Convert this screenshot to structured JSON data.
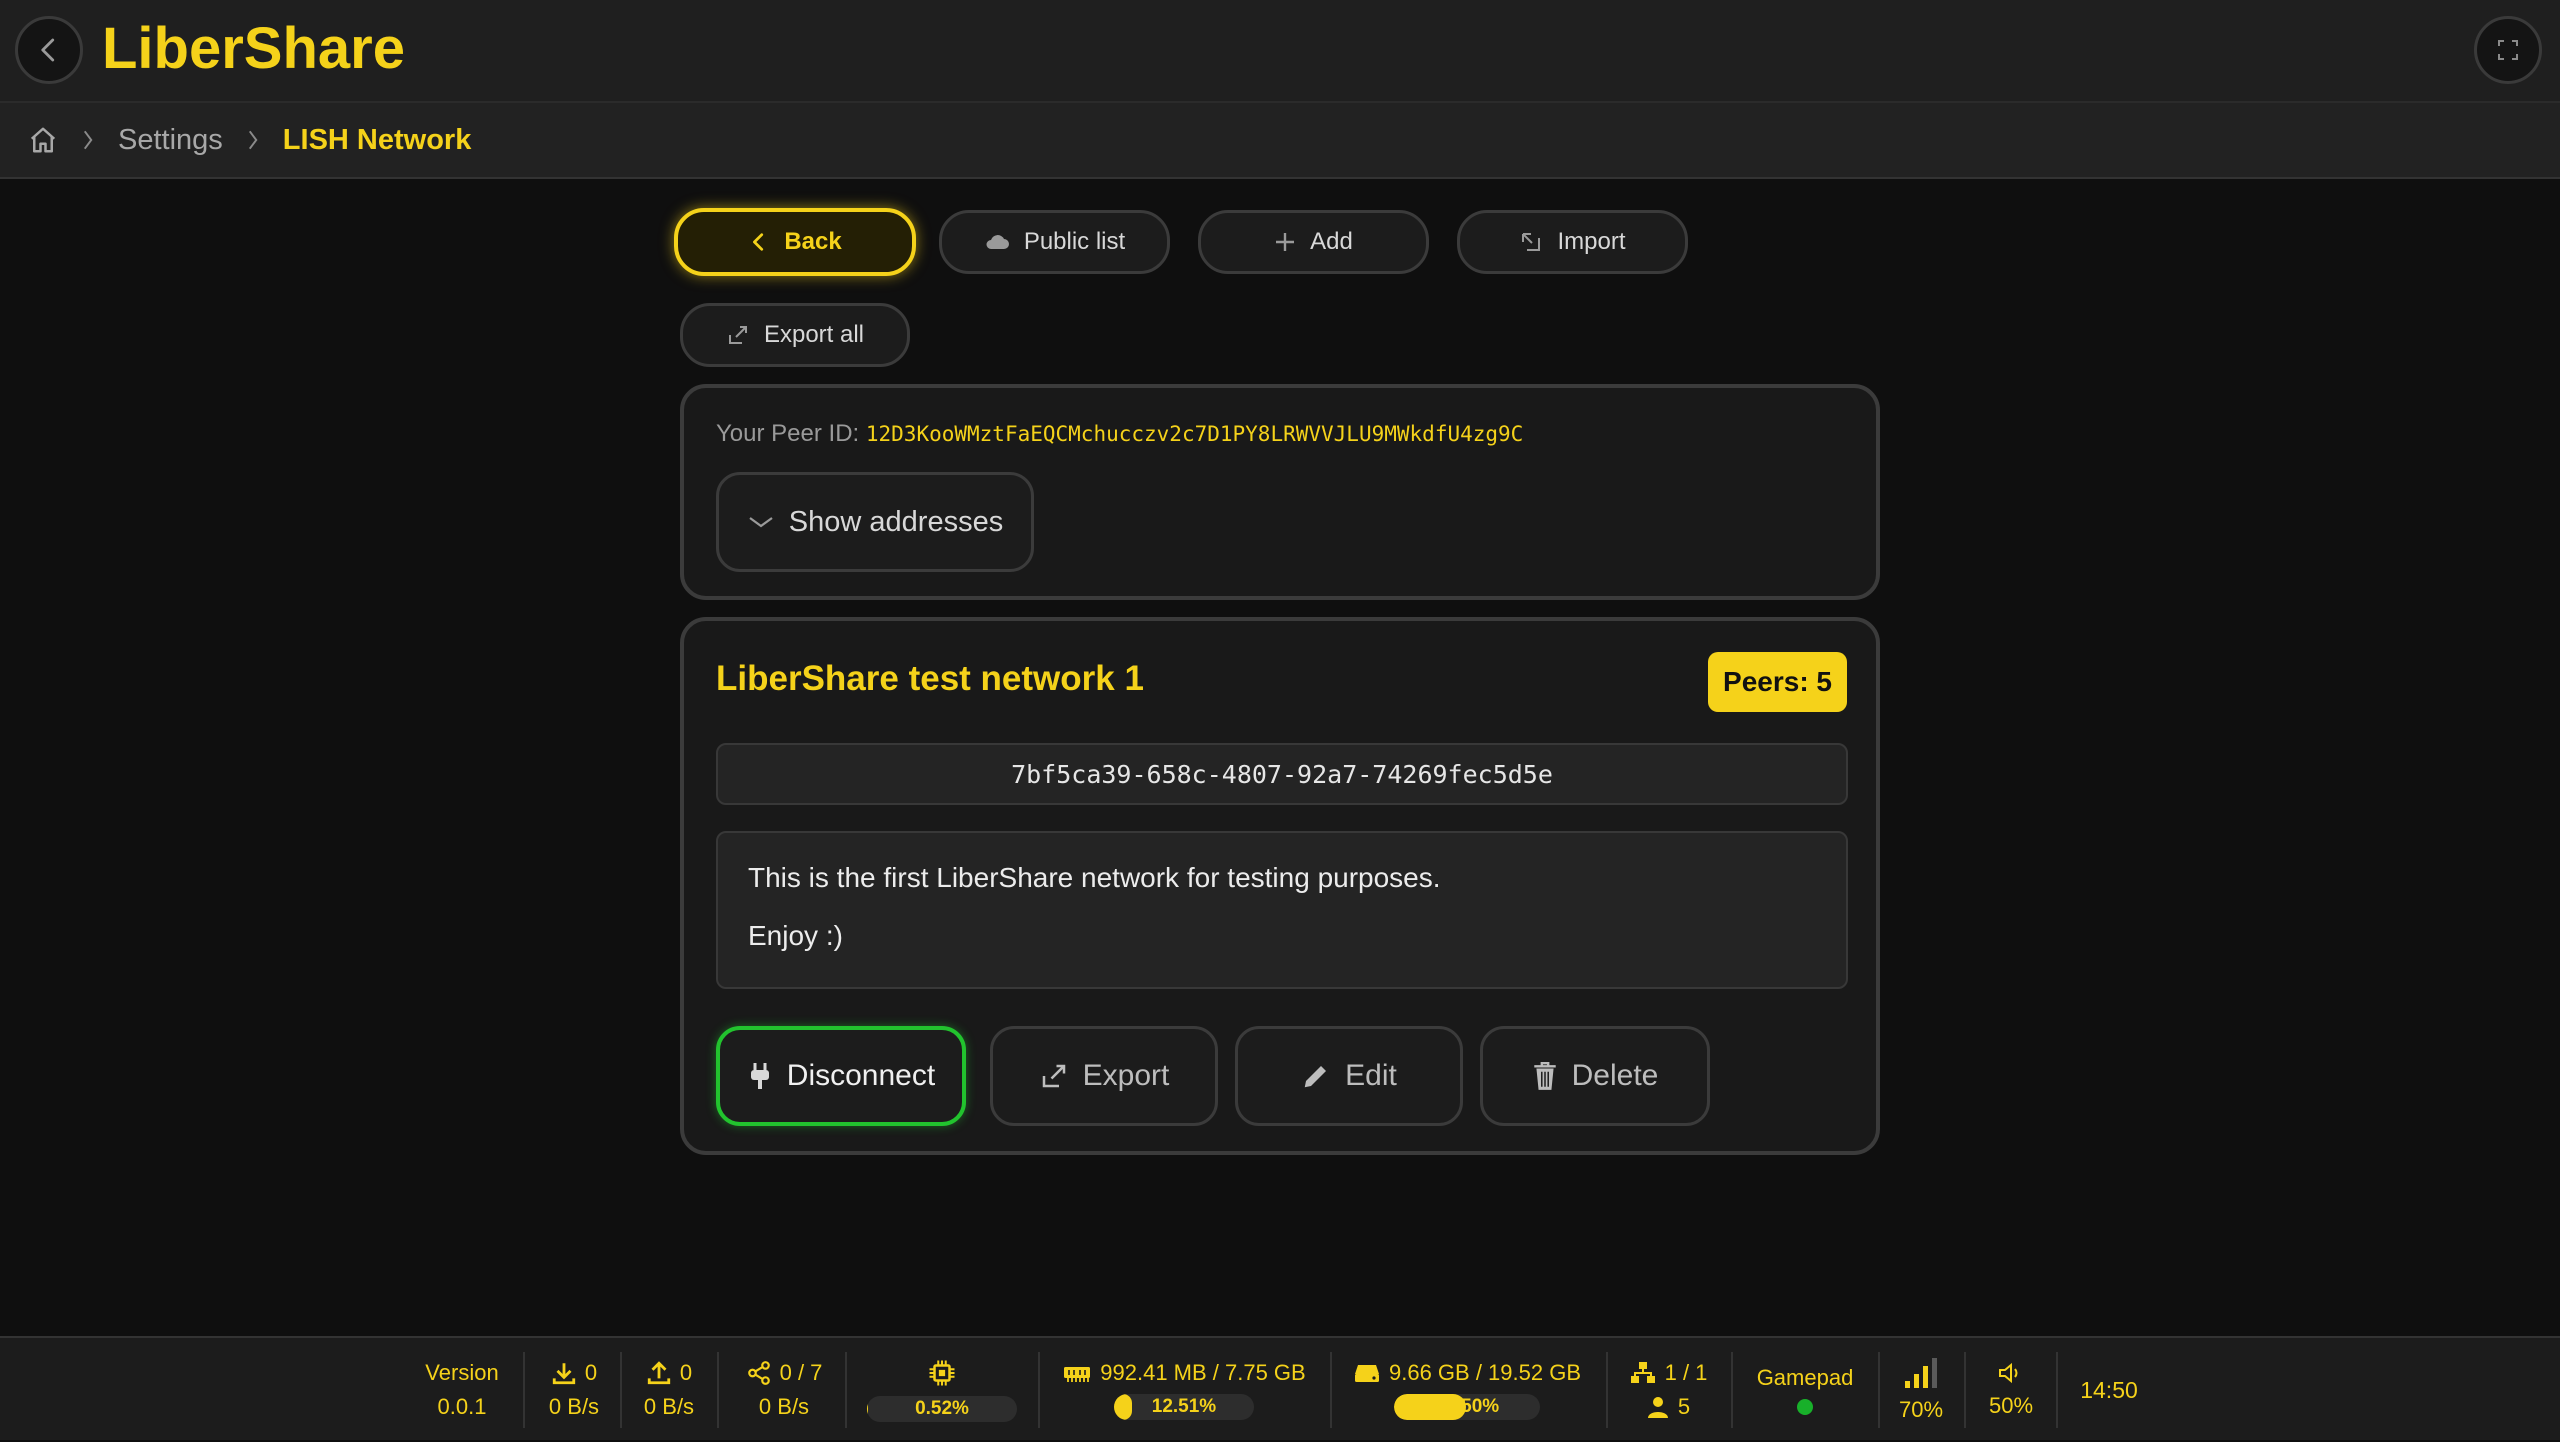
{
  "app": {
    "title": "LiberShare"
  },
  "breadcrumb": {
    "home_icon": "home-icon",
    "items": [
      "Settings",
      "LISH Network"
    ]
  },
  "toolbar": {
    "back_label": "Back",
    "public_list_label": "Public list",
    "add_label": "Add",
    "import_label": "Import",
    "export_all_label": "Export all"
  },
  "peer": {
    "label": "Your Peer ID:",
    "id": "12D3KooWMztFaEQCMchucczv2c7D1PY8LRWVVJLU9MWkdfU4zg9C",
    "show_addresses_label": "Show addresses"
  },
  "network": {
    "title": "LiberShare test network 1",
    "peers_badge": "Peers: 5",
    "uuid": "7bf5ca39-658c-4807-92a7-74269fec5d5e",
    "description_lines": [
      "This is the first LiberShare network for testing purposes.",
      "Enjoy :)"
    ],
    "actions": {
      "disconnect": "Disconnect",
      "export": "Export",
      "edit": "Edit",
      "delete": "Delete"
    }
  },
  "status": {
    "version_label": "Version",
    "version": "0.0.1",
    "download_count": "0",
    "download_speed": "0 B/s",
    "upload_count": "0",
    "upload_speed": "0 B/s",
    "share_count": "0 / 7",
    "share_speed": "0 B/s",
    "cpu": {
      "label": "0.52%",
      "fraction": 0.0052
    },
    "ram": {
      "text": "992.41 MB / 7.75 GB",
      "label": "12.51%",
      "fraction": 0.1251
    },
    "disk": {
      "text": "9.66 GB / 19.52 GB",
      "label": "49.50%",
      "fraction": 0.495
    },
    "lan": "1 / 1",
    "users": "5",
    "gamepad_label": "Gamepad",
    "signal": "70%",
    "volume": "50%",
    "clock": "14:50"
  },
  "colors": {
    "accent": "#f5d21a",
    "connected": "#22c32e",
    "background": "#0f0f0f"
  }
}
